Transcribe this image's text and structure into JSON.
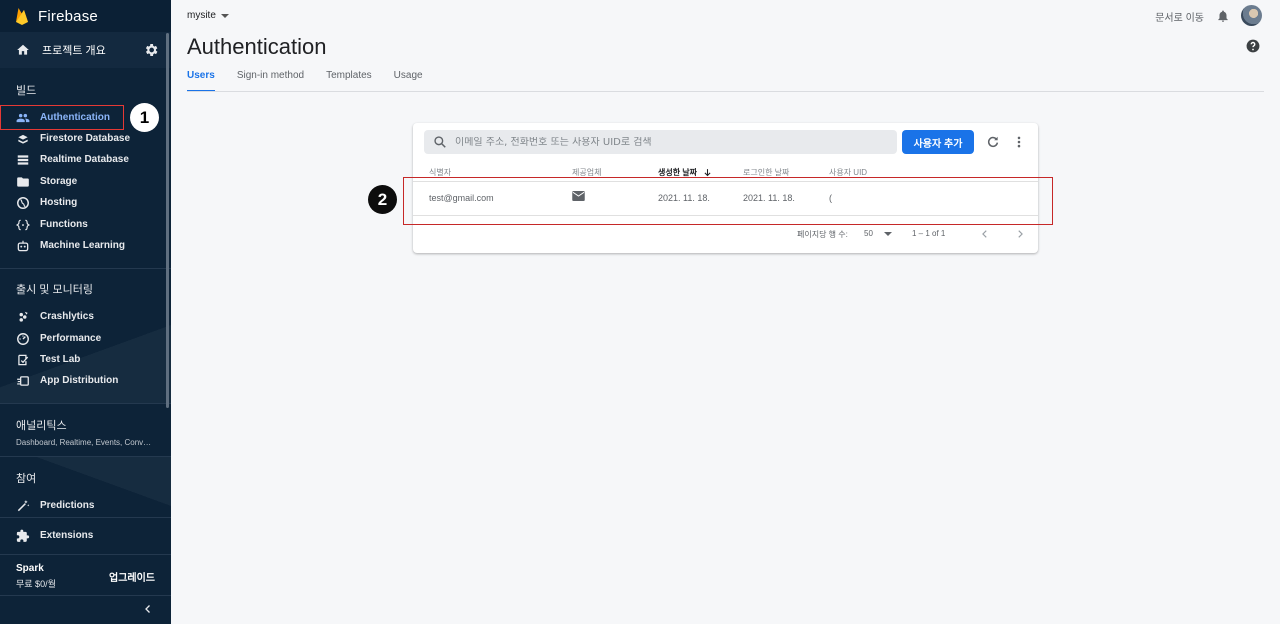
{
  "sidebar": {
    "brand": "Firebase",
    "overview_label": "프로젝트 개요",
    "section_build": "빌드",
    "build_items": [
      {
        "label": "Authentication",
        "icon": "people-icon"
      },
      {
        "label": "Firestore Database",
        "icon": "firestore-icon"
      },
      {
        "label": "Realtime Database",
        "icon": "database-icon"
      },
      {
        "label": "Storage",
        "icon": "folder-icon"
      },
      {
        "label": "Hosting",
        "icon": "globe-icon"
      },
      {
        "label": "Functions",
        "icon": "functions-icon"
      },
      {
        "label": "Machine Learning",
        "icon": "robot-icon"
      }
    ],
    "section_release": "출시 및 모니터링",
    "release_items": [
      {
        "label": "Crashlytics",
        "icon": "crashlytics-icon"
      },
      {
        "label": "Performance",
        "icon": "speedometer-icon"
      },
      {
        "label": "Test Lab",
        "icon": "checklist-icon"
      },
      {
        "label": "App Distribution",
        "icon": "distribution-icon"
      }
    ],
    "section_analytics": "애널리틱스",
    "analytics_sub": "Dashboard, Realtime, Events, Conv…",
    "section_engage": "참여",
    "engage_items": [
      {
        "label": "Predictions",
        "icon": "wand-icon"
      }
    ],
    "extensions_label": "Extensions",
    "plan_name": "Spark",
    "plan_price": "무료 $0/월",
    "upgrade_label": "업그레이드"
  },
  "annotations": {
    "first": "1",
    "second": "2"
  },
  "topbar": {
    "project": "mysite",
    "docs_link": "문서로 이동"
  },
  "page": {
    "title": "Authentication",
    "tabs": [
      "Users",
      "Sign-in method",
      "Templates",
      "Usage"
    ]
  },
  "users": {
    "search_placeholder": "이메일 주소, 전화번호 또는 사용자 UID로 검색",
    "add_button": "사용자 추가",
    "columns": [
      "식별자",
      "제공업체",
      "생성한 날짜",
      "로그인한 날짜",
      "사용자 UID"
    ],
    "rows": [
      {
        "identifier": "test@gmail.com",
        "provider": "email",
        "created": "2021. 11. 18.",
        "signed_in": "2021. 11. 18.",
        "uid": "("
      }
    ],
    "pager": {
      "rows_per_page_label": "페이지당 행 수:",
      "rows_per_page": "50",
      "range": "1 – 1 of 1"
    }
  },
  "colors": {
    "sidebar_bg": "#0d2338",
    "accent": "#1a73e8",
    "active_nav": "#8ab4f8",
    "annotation": "#e53935"
  }
}
